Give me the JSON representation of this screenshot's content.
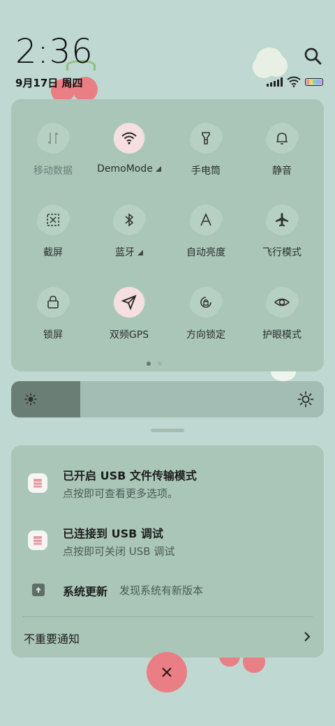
{
  "status": {
    "time": "2:36",
    "date": "9月17日 周四"
  },
  "quick_tiles": [
    {
      "label": "移动数据",
      "icon": "mobile-data-icon",
      "active": false,
      "dim": true
    },
    {
      "label": "DemoMode",
      "icon": "wifi-icon",
      "active": true,
      "dim": false,
      "has_arrow": true
    },
    {
      "label": "手电筒",
      "icon": "flashlight-icon",
      "active": false,
      "dim": false
    },
    {
      "label": "静音",
      "icon": "bell-icon",
      "active": false,
      "dim": false
    },
    {
      "label": "截屏",
      "icon": "screenshot-icon",
      "active": false,
      "dim": false
    },
    {
      "label": "蓝牙",
      "icon": "bluetooth-icon",
      "active": false,
      "dim": false,
      "has_arrow": true
    },
    {
      "label": "自动亮度",
      "icon": "auto-brightness-icon",
      "active": false,
      "dim": false
    },
    {
      "label": "飞行模式",
      "icon": "airplane-icon",
      "active": false,
      "dim": false
    },
    {
      "label": "锁屏",
      "icon": "lock-icon",
      "active": false,
      "dim": false
    },
    {
      "label": "双频GPS",
      "icon": "gps-icon",
      "active": true,
      "dim": false
    },
    {
      "label": "方向锁定",
      "icon": "rotation-lock-icon",
      "active": false,
      "dim": false
    },
    {
      "label": "护眼模式",
      "icon": "eye-icon",
      "active": false,
      "dim": false
    }
  ],
  "pager": {
    "pages": 2,
    "current": 1
  },
  "brightness": {
    "level": 0.22
  },
  "notifications": [
    {
      "title": "已开启 USB 文件传输模式",
      "subtitle": "点按即可查看更多选项。"
    },
    {
      "title": "已连接到 USB 调试",
      "subtitle": "点按即可关闭 USB 调试"
    }
  ],
  "system_update": {
    "title": "系统更新",
    "subtitle": "发现系统有新版本"
  },
  "unimportant": {
    "label": "不重要通知"
  },
  "colors": {
    "accent_pink": "#e97f84",
    "panel": "#a9c6b8",
    "background": "#bfd8d2"
  }
}
